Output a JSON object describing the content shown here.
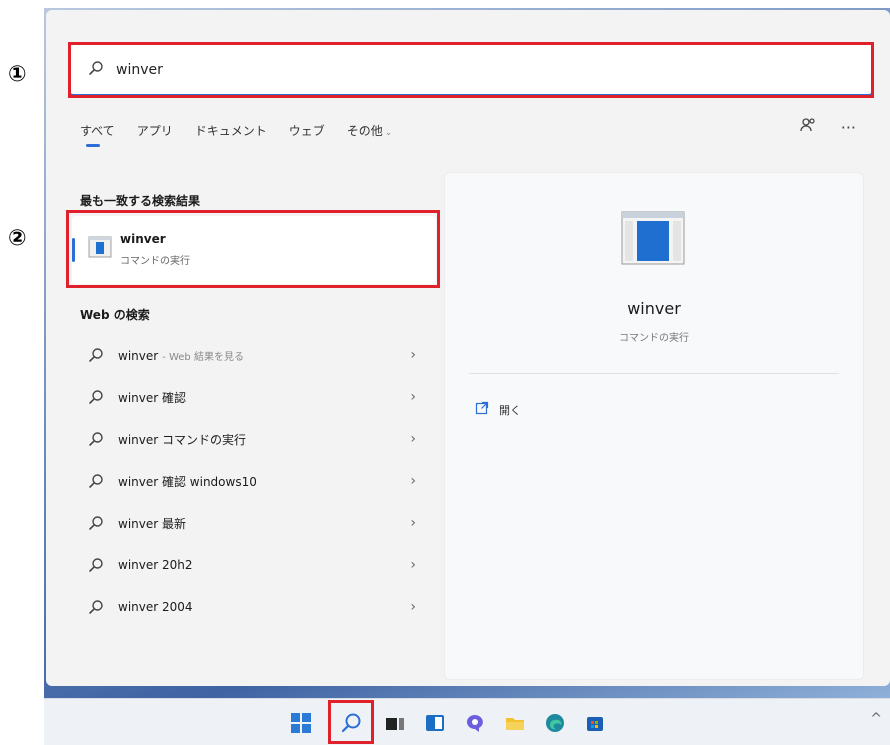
{
  "annotations": {
    "marker1": "①",
    "marker2": "②"
  },
  "search": {
    "query": "winver"
  },
  "tabs": [
    {
      "label": "すべて",
      "active": true
    },
    {
      "label": "アプリ"
    },
    {
      "label": "ドキュメント"
    },
    {
      "label": "ウェブ"
    },
    {
      "label": "その他"
    }
  ],
  "best_match": {
    "heading": "最も一致する検索結果",
    "title": "winver",
    "subtitle": "コマンドの実行"
  },
  "web_search": {
    "heading": "Web の検索",
    "items": [
      {
        "text": "winver",
        "hint": "- Web 結果を見る"
      },
      {
        "text": "winver 確認"
      },
      {
        "text": "winver コマンドの実行"
      },
      {
        "text": "winver 確認 windows10"
      },
      {
        "text": "winver 最新"
      },
      {
        "text": "winver 20h2"
      },
      {
        "text": "winver 2004"
      }
    ]
  },
  "preview": {
    "title": "winver",
    "subtitle": "コマンドの実行",
    "action_label": "開く"
  },
  "colors": {
    "accent": "#2b6fd6",
    "highlight": "#e0202a"
  }
}
